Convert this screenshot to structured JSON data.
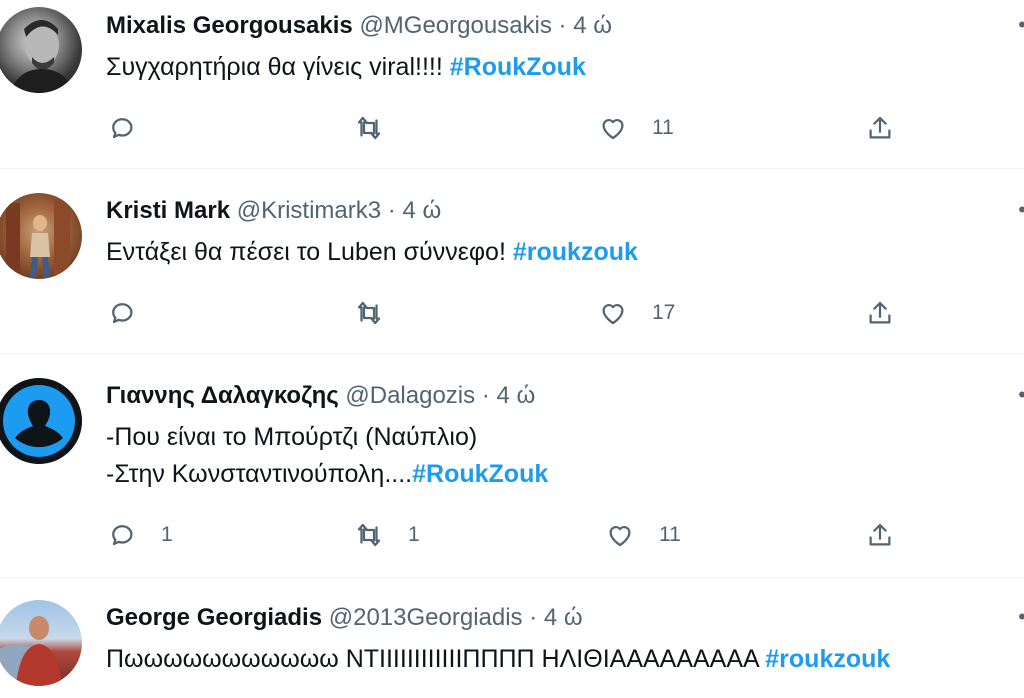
{
  "colors": {
    "hashtag": "#1d9bf0",
    "meta": "#536471",
    "text": "#0f1419",
    "divider": "#eff3f4"
  },
  "tweets": [
    {
      "name": "Mixalis Georgousakis",
      "handle": "@MGeorgousakis",
      "sep": "·",
      "time": "4 ώ",
      "text_lines": [
        {
          "plain": "Συγχαρητήρια θα γίνεις viral!!!! ",
          "hashtag": "#RoukZouk"
        }
      ],
      "replies": "",
      "retweets": "",
      "likes": "11"
    },
    {
      "name": "Kristi Mark",
      "handle": "@Kristimark3",
      "sep": "·",
      "time": "4 ώ",
      "text_lines": [
        {
          "plain": "Εντάξει θα πέσει το Luben σύννεφο! ",
          "hashtag": "#roukzouk"
        }
      ],
      "replies": "",
      "retweets": "",
      "likes": "17"
    },
    {
      "name": "Γιαννης Δαλαγκοζης",
      "handle": "@Dalagozis",
      "sep": "·",
      "time": "4 ώ",
      "text_lines": [
        {
          "plain": "-Που είναι το Μπούρτζι (Ναύπλιο)",
          "hashtag": ""
        },
        {
          "plain": "-Στην Κωνσταντινούπολη....",
          "hashtag": "#RoukZouk"
        }
      ],
      "replies": "1",
      "retweets": "1",
      "likes": "11"
    },
    {
      "name": "George Georgiadis",
      "handle": "@2013Georgiadis",
      "sep": "·",
      "time": "4 ώ",
      "text_lines": [
        {
          "plain": "Πωωωωωωωωωωω ΝΤΙΙΙΙΙΙΙΙΙΙΙΙΠΠΠΠ ΗΛΙΘΙΑΑΑΑΑΑΑΑΑ ",
          "hashtag": "#roukzouk"
        }
      ]
    }
  ],
  "icons": {
    "reply": "reply-icon",
    "retweet": "retweet-icon",
    "like": "heart-icon",
    "share": "share-icon",
    "more": "more-dots-icon"
  }
}
